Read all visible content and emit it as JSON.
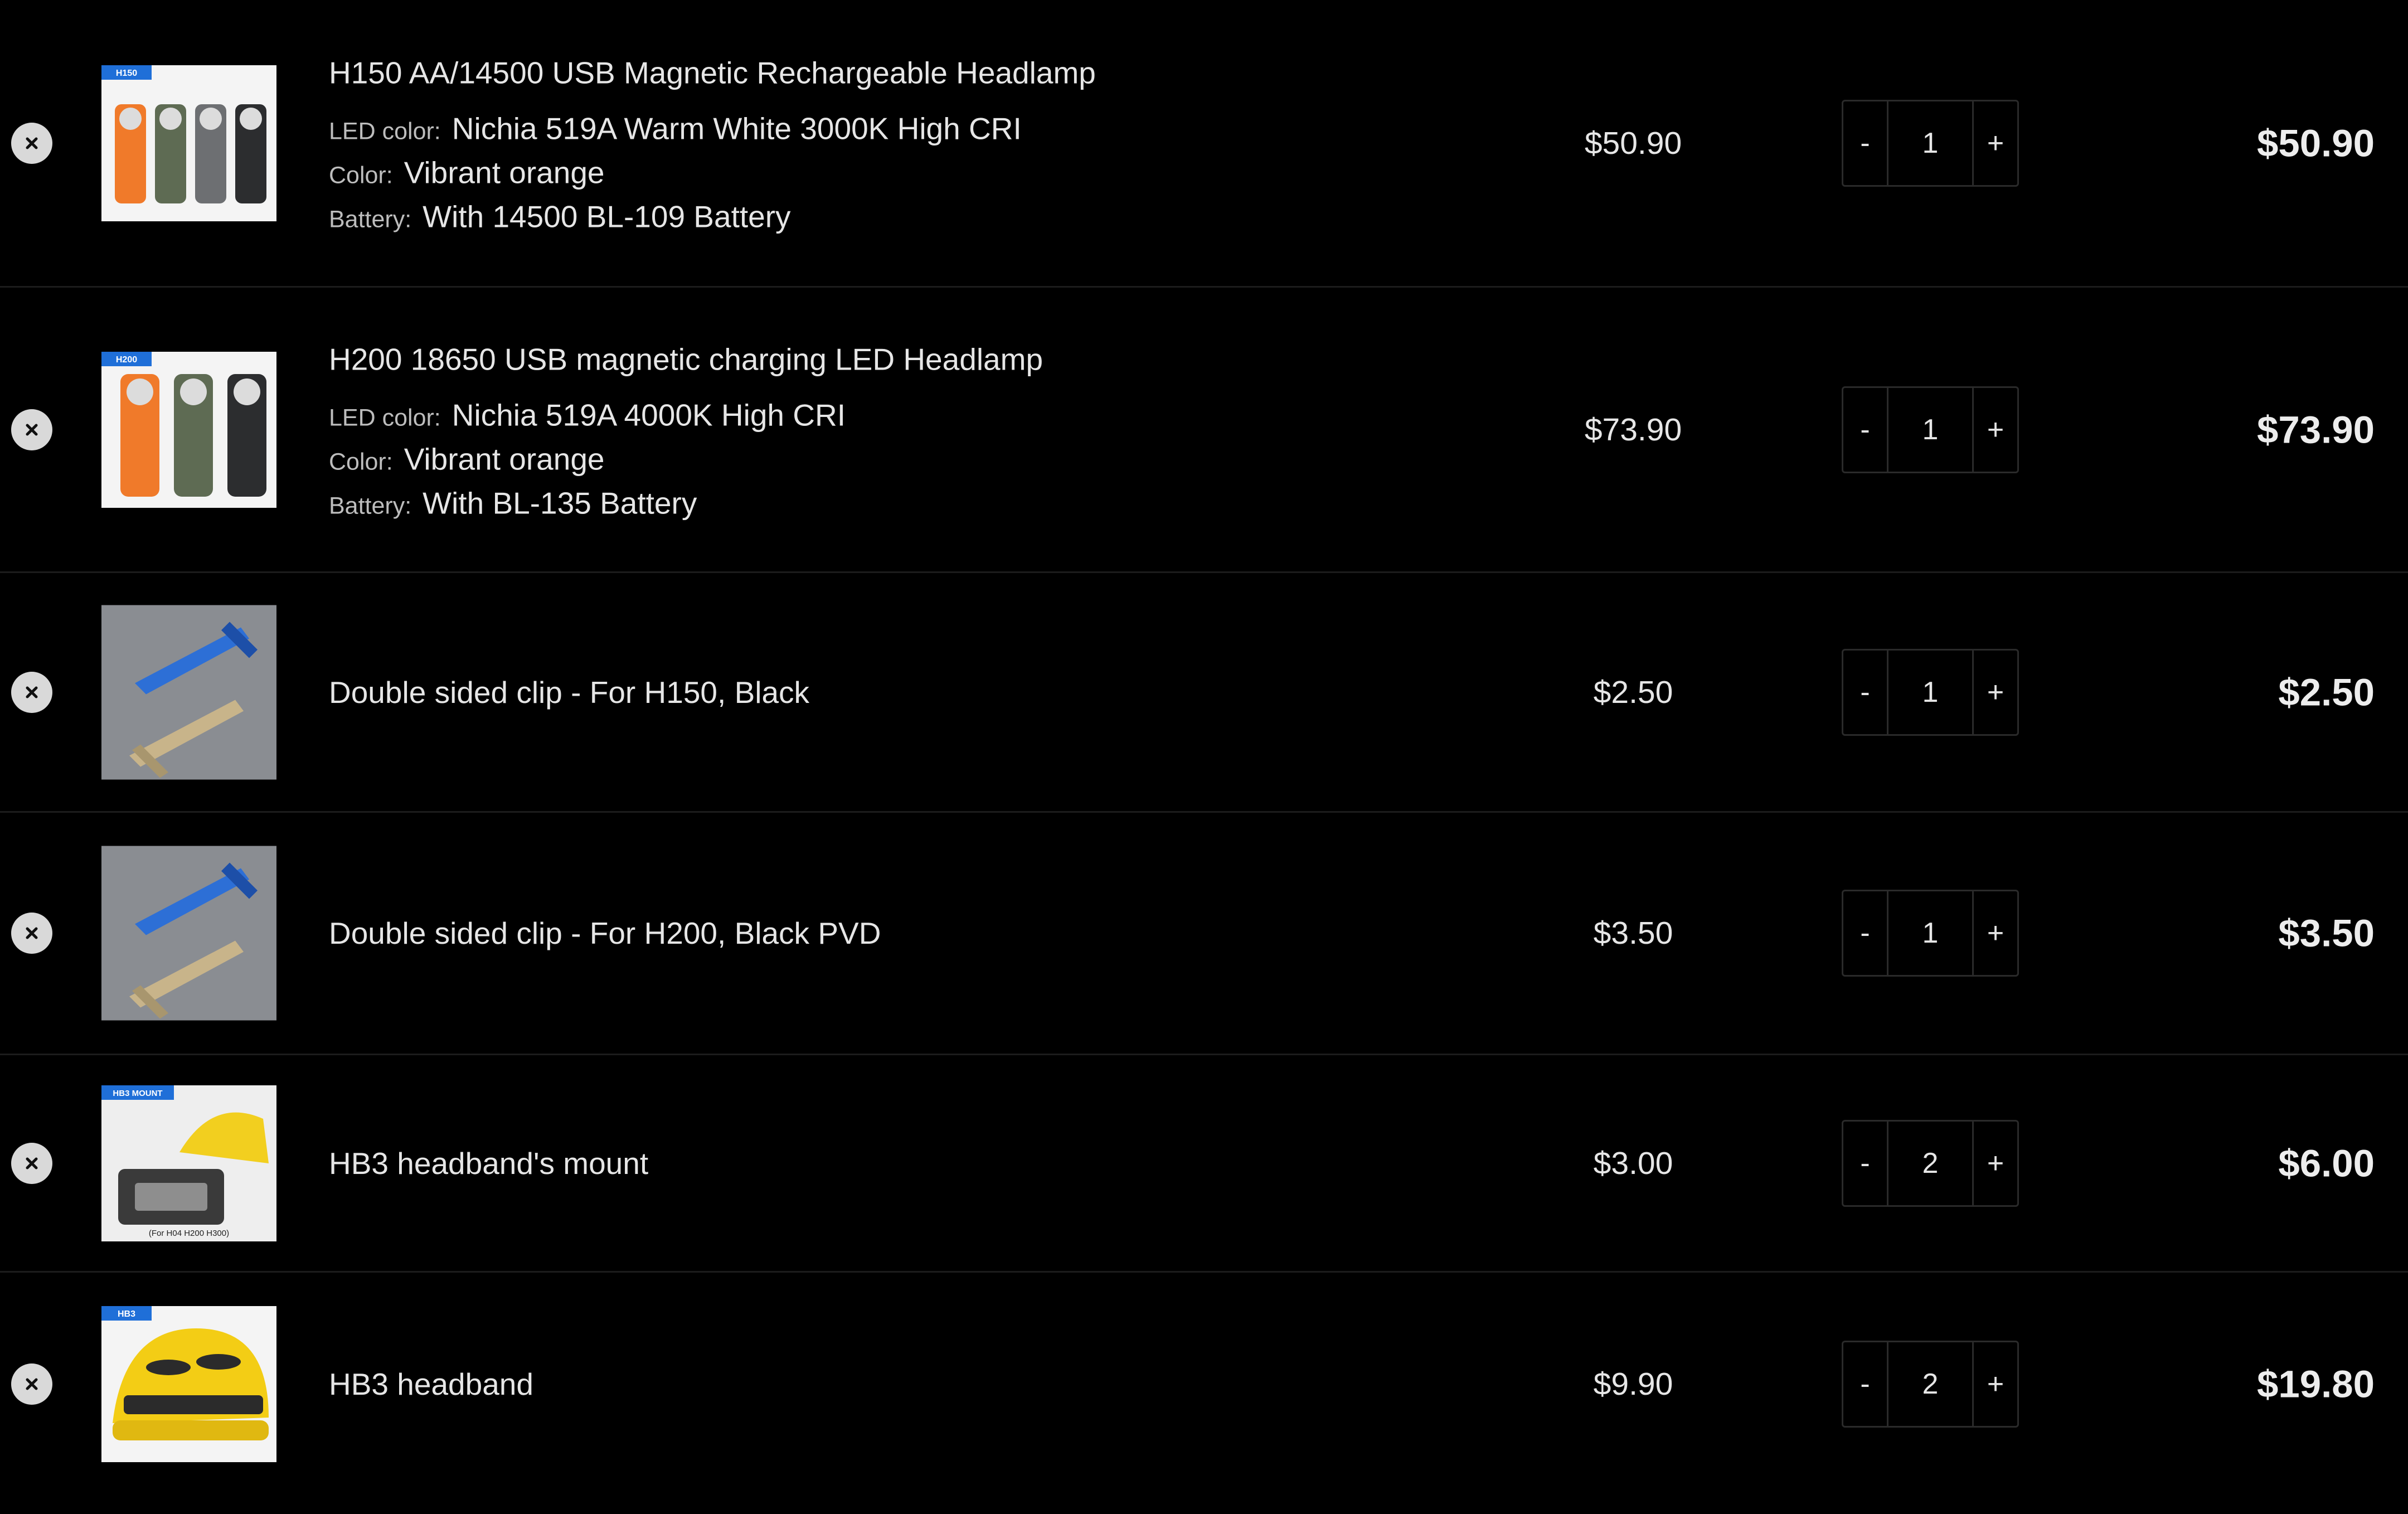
{
  "cart": {
    "items": [
      {
        "name": "H150 AA/14500 USB Magnetic Rechargeable Headlamp",
        "image_icon": "h150-headlamp-product-image",
        "image_badge": "H150",
        "variants": [
          {
            "label": "LED color:",
            "value": "Nichia 519A Warm White 3000K High CRI"
          },
          {
            "label": "Color:",
            "value": "Vibrant orange"
          },
          {
            "label": "Battery:",
            "value": "With 14500 BL-109 Battery"
          }
        ],
        "unit_price": "$50.90",
        "quantity": "1",
        "line_total": "$50.90"
      },
      {
        "name": "H200 18650 USB magnetic charging LED Headlamp",
        "image_icon": "h200-headlamp-product-image",
        "image_badge": "H200",
        "variants": [
          {
            "label": "LED color:",
            "value": "Nichia 519A 4000K High CRI"
          },
          {
            "label": "Color:",
            "value": "Vibrant orange"
          },
          {
            "label": "Battery:",
            "value": "With BL-135 Battery"
          }
        ],
        "unit_price": "$73.90",
        "quantity": "1",
        "line_total": "$73.90"
      },
      {
        "name": "Double sided clip - For H150, Black",
        "image_icon": "double-sided-clip-product-image",
        "variants": [],
        "unit_price": "$2.50",
        "quantity": "1",
        "line_total": "$2.50"
      },
      {
        "name": "Double sided clip - For H200, Black PVD",
        "image_icon": "double-sided-clip-product-image",
        "variants": [],
        "unit_price": "$3.50",
        "quantity": "1",
        "line_total": "$3.50"
      },
      {
        "name": "HB3 headband's mount",
        "image_icon": "headband-mount-product-image",
        "image_badge": "HB3 MOUNT",
        "image_caption": "(For H04 H200 H300)",
        "variants": [],
        "unit_price": "$3.00",
        "quantity": "2",
        "line_total": "$6.00"
      },
      {
        "name": "HB3 headband",
        "image_icon": "yellow-helmet-headband-product-image",
        "image_badge": "HB3",
        "variants": [],
        "unit_price": "$9.90",
        "quantity": "2",
        "line_total": "$19.80"
      }
    ],
    "controls": {
      "remove_icon": "close-icon",
      "decrement_label": "-",
      "increment_label": "+"
    },
    "colors": {
      "background": "#000000",
      "text": "#e6e6e6",
      "divider": "#1c1c1c",
      "remove_button": "#d9d9d9",
      "qty_border": "#2a2a2a"
    }
  }
}
